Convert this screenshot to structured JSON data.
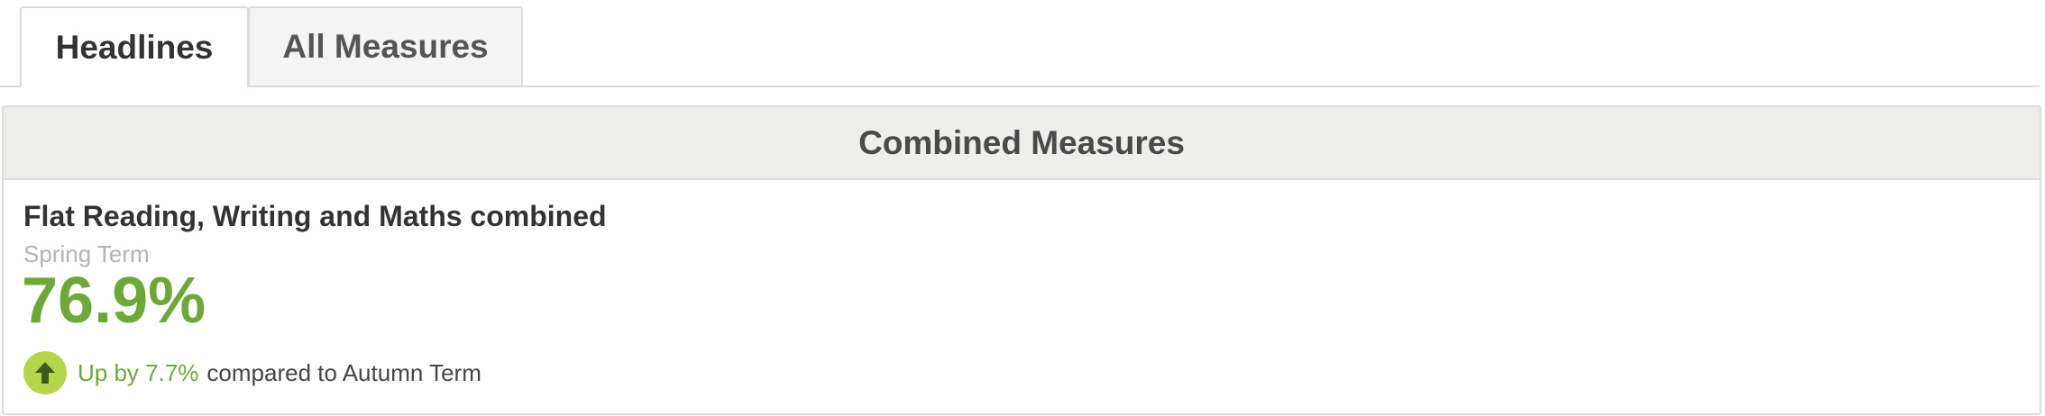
{
  "tabs": {
    "headlines_label": "Headlines",
    "all_measures_label": "All Measures",
    "active": "Headlines"
  },
  "panel": {
    "header": "Combined Measures",
    "measure": {
      "title": "Flat Reading, Writing and Maths combined",
      "term": "Spring Term",
      "value": "76.9%",
      "change_direction_icon": "arrow-up-icon",
      "change_text": "Up by 7.7%",
      "comparison_text": "compared to Autumn Term"
    }
  },
  "colors": {
    "accent_green": "#6ea83a",
    "icon_circle": "#b4d64a",
    "header_bg": "#eeeeec",
    "border": "#dcdcdc"
  }
}
